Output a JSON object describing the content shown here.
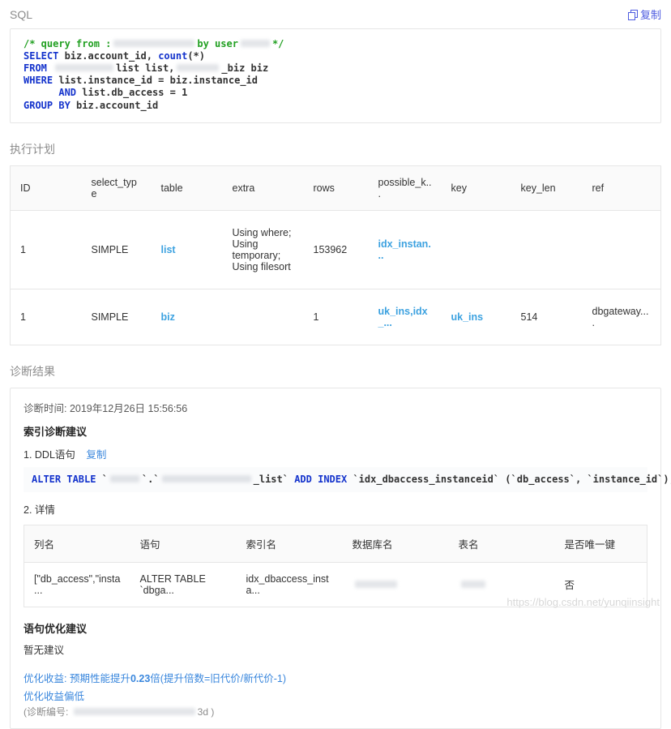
{
  "sql_section": {
    "title": "SQL",
    "copy_label": "复制",
    "code": [
      [
        {
          "c": "com",
          "v": "/* query from :"
        },
        {
          "blur": 100
        },
        {
          "c": "com",
          "v": "by user"
        },
        {
          "blur": 36
        },
        {
          "c": "com",
          "v": "*/"
        }
      ],
      [
        {
          "c": "kw",
          "v": "SELECT"
        },
        {
          "v": " biz.account_id, "
        },
        {
          "c": "kw",
          "v": "count"
        },
        {
          "v": "(*)"
        }
      ],
      [
        {
          "c": "kw",
          "v": "FROM"
        },
        {
          "v": " "
        },
        {
          "blur": 72
        },
        {
          "v": "list list,"
        },
        {
          "blur": 52
        },
        {
          "v": "_biz biz"
        }
      ],
      [
        {
          "c": "kw",
          "v": "WHERE"
        },
        {
          "v": " list.instance_id = biz.instance_id"
        }
      ],
      [
        {
          "v": "      "
        },
        {
          "c": "kw",
          "v": "AND"
        },
        {
          "v": " list.db_access = 1"
        }
      ],
      [
        {
          "c": "kw",
          "v": "GROUP BY"
        },
        {
          "v": " biz.account_id"
        }
      ]
    ]
  },
  "plan_section": {
    "title": "执行计划",
    "table": {
      "headers": [
        "ID",
        "select_type",
        "table",
        "extra",
        "rows",
        "possible_k...",
        "key",
        "key_len",
        "ref"
      ],
      "rows": [
        [
          "1",
          "SIMPLE",
          {
            "v": "list",
            "link": true
          },
          "Using where; Using temporary; Using filesort",
          "153962",
          {
            "v": "idx_instan...",
            "link": true
          },
          "",
          "",
          ""
        ],
        [
          "1",
          "SIMPLE",
          {
            "v": "biz",
            "link": true
          },
          "",
          "1",
          {
            "v": "uk_ins,idx_...",
            "link": true
          },
          {
            "v": "uk_ins",
            "link": true
          },
          "514",
          "dbgateway...."
        ]
      ]
    }
  },
  "diagnosis": {
    "title": "诊断结果",
    "time": "诊断时间: 2019年12月26日 15:56:56",
    "index_advice_title": "索引诊断建议",
    "ddl_label": "1. DDL语句",
    "copy_label": "复制",
    "ddl_code": [
      [
        {
          "c": "kw",
          "v": "ALTER TABLE"
        },
        {
          "v": " `"
        },
        {
          "blur": 36
        },
        {
          "v": "`.`"
        },
        {
          "blur": 110
        },
        {
          "v": "_list` "
        },
        {
          "c": "kw",
          "v": "ADD INDEX"
        },
        {
          "v": " `idx_dbaccess_instanceid` (`db_access`, `instance_id`);"
        }
      ]
    ],
    "detail_label": "2. 详情",
    "detail_table": {
      "headers": [
        "列名",
        "语句",
        "索引名",
        "数据库名",
        "表名",
        "是否唯一键"
      ],
      "rows": [
        [
          "[\"db_access\",\"insta...",
          "ALTER TABLE `dbga...",
          "idx_dbaccess_insta...",
          {
            "blur": 52
          },
          {
            "blur": 30
          },
          "否"
        ]
      ]
    },
    "stmt_advice_title": "语句优化建议",
    "stmt_advice_body": "暂无建议",
    "benefit_prefix": "优化收益: 预期性能提升",
    "benefit_value": "0.23",
    "benefit_suffix": "倍(提升倍数=旧代价/新代价-1)",
    "benefit_low": "优化收益偏低",
    "diag_no_prefix": "(诊断编号: ",
    "diag_no_suffix": "3d )"
  },
  "watermark": "https://blog.csdn.net/yunqiinsight"
}
